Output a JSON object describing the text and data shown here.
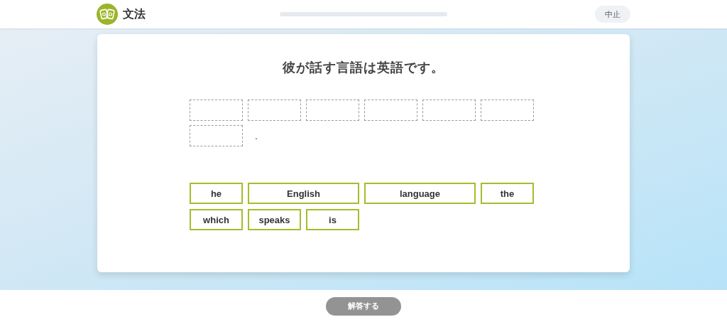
{
  "header": {
    "title": "文法",
    "progress": {
      "level": 0
    },
    "quit_button": "中止"
  },
  "question": {
    "prompt": "彼が話す言語は英語です。",
    "answer_slots": [
      {
        "kind": "blank"
      },
      {
        "kind": "blank"
      },
      {
        "kind": "blank"
      },
      {
        "kind": "blank"
      },
      {
        "kind": "blank"
      },
      {
        "kind": "blank"
      },
      {
        "kind": "blank"
      }
    ],
    "ending": ".",
    "word_choices": [
      {
        "label": "he"
      },
      {
        "label": "English"
      },
      {
        "label": "language"
      },
      {
        "label": "the"
      },
      {
        "label": "which"
      },
      {
        "label": "speaks"
      },
      {
        "label": "is"
      }
    ]
  },
  "footer": {
    "submit_button": {
      "label": "解答する",
      "disabled": true
    }
  }
}
